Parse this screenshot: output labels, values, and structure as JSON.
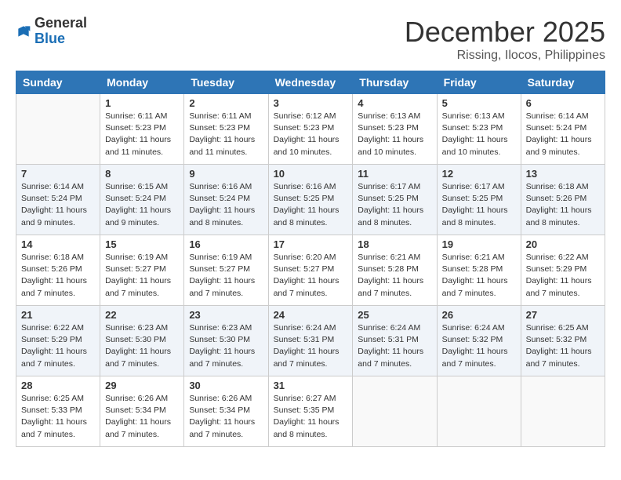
{
  "logo": {
    "general": "General",
    "blue": "Blue"
  },
  "title": {
    "month": "December 2025",
    "location": "Rissing, Ilocos, Philippines"
  },
  "headers": [
    "Sunday",
    "Monday",
    "Tuesday",
    "Wednesday",
    "Thursday",
    "Friday",
    "Saturday"
  ],
  "weeks": [
    [
      {
        "day": "",
        "info": ""
      },
      {
        "day": "1",
        "info": "Sunrise: 6:11 AM\nSunset: 5:23 PM\nDaylight: 11 hours\nand 11 minutes."
      },
      {
        "day": "2",
        "info": "Sunrise: 6:11 AM\nSunset: 5:23 PM\nDaylight: 11 hours\nand 11 minutes."
      },
      {
        "day": "3",
        "info": "Sunrise: 6:12 AM\nSunset: 5:23 PM\nDaylight: 11 hours\nand 10 minutes."
      },
      {
        "day": "4",
        "info": "Sunrise: 6:13 AM\nSunset: 5:23 PM\nDaylight: 11 hours\nand 10 minutes."
      },
      {
        "day": "5",
        "info": "Sunrise: 6:13 AM\nSunset: 5:23 PM\nDaylight: 11 hours\nand 10 minutes."
      },
      {
        "day": "6",
        "info": "Sunrise: 6:14 AM\nSunset: 5:24 PM\nDaylight: 11 hours\nand 9 minutes."
      }
    ],
    [
      {
        "day": "7",
        "info": "Sunrise: 6:14 AM\nSunset: 5:24 PM\nDaylight: 11 hours\nand 9 minutes."
      },
      {
        "day": "8",
        "info": "Sunrise: 6:15 AM\nSunset: 5:24 PM\nDaylight: 11 hours\nand 9 minutes."
      },
      {
        "day": "9",
        "info": "Sunrise: 6:16 AM\nSunset: 5:24 PM\nDaylight: 11 hours\nand 8 minutes."
      },
      {
        "day": "10",
        "info": "Sunrise: 6:16 AM\nSunset: 5:25 PM\nDaylight: 11 hours\nand 8 minutes."
      },
      {
        "day": "11",
        "info": "Sunrise: 6:17 AM\nSunset: 5:25 PM\nDaylight: 11 hours\nand 8 minutes."
      },
      {
        "day": "12",
        "info": "Sunrise: 6:17 AM\nSunset: 5:25 PM\nDaylight: 11 hours\nand 8 minutes."
      },
      {
        "day": "13",
        "info": "Sunrise: 6:18 AM\nSunset: 5:26 PM\nDaylight: 11 hours\nand 8 minutes."
      }
    ],
    [
      {
        "day": "14",
        "info": "Sunrise: 6:18 AM\nSunset: 5:26 PM\nDaylight: 11 hours\nand 7 minutes."
      },
      {
        "day": "15",
        "info": "Sunrise: 6:19 AM\nSunset: 5:27 PM\nDaylight: 11 hours\nand 7 minutes."
      },
      {
        "day": "16",
        "info": "Sunrise: 6:19 AM\nSunset: 5:27 PM\nDaylight: 11 hours\nand 7 minutes."
      },
      {
        "day": "17",
        "info": "Sunrise: 6:20 AM\nSunset: 5:27 PM\nDaylight: 11 hours\nand 7 minutes."
      },
      {
        "day": "18",
        "info": "Sunrise: 6:21 AM\nSunset: 5:28 PM\nDaylight: 11 hours\nand 7 minutes."
      },
      {
        "day": "19",
        "info": "Sunrise: 6:21 AM\nSunset: 5:28 PM\nDaylight: 11 hours\nand 7 minutes."
      },
      {
        "day": "20",
        "info": "Sunrise: 6:22 AM\nSunset: 5:29 PM\nDaylight: 11 hours\nand 7 minutes."
      }
    ],
    [
      {
        "day": "21",
        "info": "Sunrise: 6:22 AM\nSunset: 5:29 PM\nDaylight: 11 hours\nand 7 minutes."
      },
      {
        "day": "22",
        "info": "Sunrise: 6:23 AM\nSunset: 5:30 PM\nDaylight: 11 hours\nand 7 minutes."
      },
      {
        "day": "23",
        "info": "Sunrise: 6:23 AM\nSunset: 5:30 PM\nDaylight: 11 hours\nand 7 minutes."
      },
      {
        "day": "24",
        "info": "Sunrise: 6:24 AM\nSunset: 5:31 PM\nDaylight: 11 hours\nand 7 minutes."
      },
      {
        "day": "25",
        "info": "Sunrise: 6:24 AM\nSunset: 5:31 PM\nDaylight: 11 hours\nand 7 minutes."
      },
      {
        "day": "26",
        "info": "Sunrise: 6:24 AM\nSunset: 5:32 PM\nDaylight: 11 hours\nand 7 minutes."
      },
      {
        "day": "27",
        "info": "Sunrise: 6:25 AM\nSunset: 5:32 PM\nDaylight: 11 hours\nand 7 minutes."
      }
    ],
    [
      {
        "day": "28",
        "info": "Sunrise: 6:25 AM\nSunset: 5:33 PM\nDaylight: 11 hours\nand 7 minutes."
      },
      {
        "day": "29",
        "info": "Sunrise: 6:26 AM\nSunset: 5:34 PM\nDaylight: 11 hours\nand 7 minutes."
      },
      {
        "day": "30",
        "info": "Sunrise: 6:26 AM\nSunset: 5:34 PM\nDaylight: 11 hours\nand 7 minutes."
      },
      {
        "day": "31",
        "info": "Sunrise: 6:27 AM\nSunset: 5:35 PM\nDaylight: 11 hours\nand 8 minutes."
      },
      {
        "day": "",
        "info": ""
      },
      {
        "day": "",
        "info": ""
      },
      {
        "day": "",
        "info": ""
      }
    ]
  ]
}
